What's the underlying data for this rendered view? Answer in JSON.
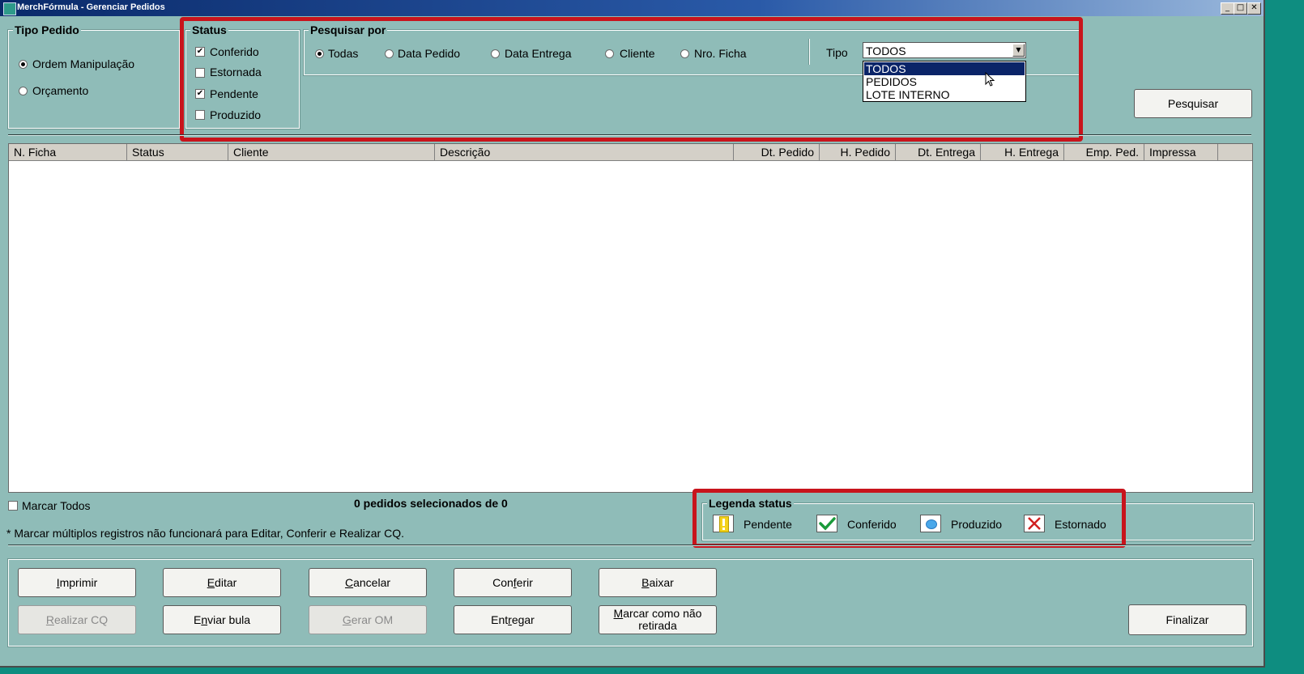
{
  "window": {
    "title": "MerchFórmula - Gerenciar Pedidos"
  },
  "tipo_pedido": {
    "legend": "Tipo Pedido",
    "options": [
      {
        "label": "Ordem Manipulação",
        "selected": true
      },
      {
        "label": "Orçamento",
        "selected": false
      }
    ]
  },
  "status": {
    "legend": "Status",
    "options": [
      {
        "label": "Conferido",
        "checked": true
      },
      {
        "label": "Estornada",
        "checked": false
      },
      {
        "label": "Pendente",
        "checked": true
      },
      {
        "label": "Produzido",
        "checked": false
      }
    ]
  },
  "pesquisar_por": {
    "legend": "Pesquisar por",
    "options": [
      {
        "label": "Todas",
        "selected": true
      },
      {
        "label": "Data Pedido",
        "selected": false
      },
      {
        "label": "Data Entrega",
        "selected": false
      },
      {
        "label": "Cliente",
        "selected": false
      },
      {
        "label": "Nro. Ficha",
        "selected": false
      }
    ],
    "tipo_label": "Tipo",
    "tipo_value": "TODOS",
    "tipo_options": [
      "TODOS",
      "PEDIDOS",
      "LOTE INTERNO"
    ]
  },
  "pesquisar_button": "Pesquisar",
  "table": {
    "columns": [
      "N. Ficha",
      "Status",
      "Cliente",
      "Descrição",
      "Dt. Pedido",
      "H. Pedido",
      "Dt. Entrega",
      "H. Entrega",
      "Emp. Ped.",
      "Impressa"
    ],
    "rows": []
  },
  "marcar_todos": {
    "label": "Marcar Todos",
    "checked": false
  },
  "selection_count": "0 pedidos selecionados de 0",
  "note": "* Marcar múltiplos registros não funcionará para Editar, Conferir e Realizar CQ.",
  "legenda": {
    "legend": "Legenda status",
    "items": [
      {
        "label": "Pendente",
        "icon": "exclamation-icon"
      },
      {
        "label": "Conferido",
        "icon": "checkmark-icon"
      },
      {
        "label": "Produzido",
        "icon": "blue-dot-icon"
      },
      {
        "label": "Estornado",
        "icon": "red-x-icon"
      }
    ]
  },
  "buttons": {
    "imprimir": {
      "label": "Imprimir",
      "key": "I",
      "rest": "mprimir"
    },
    "editar": {
      "label": "Editar",
      "key": "E",
      "rest": "ditar"
    },
    "cancelar": {
      "label": "Cancelar",
      "key": "C",
      "rest": "ancelar"
    },
    "conferir": {
      "label": "Conferir",
      "pre": "Con",
      "key": "f",
      "rest": "erir"
    },
    "baixar": {
      "label": "Baixar",
      "key": "B",
      "rest": "aixar"
    },
    "realizar_cq": {
      "label": "Realizar CQ",
      "key": "R",
      "rest": "ealizar CQ",
      "disabled": true
    },
    "enviar_bula": {
      "label": "Enviar bula",
      "pre": "E",
      "key": "n",
      "rest": "viar bula"
    },
    "gerar_om": {
      "label": "Gerar OM",
      "key": "G",
      "rest": "erar OM",
      "disabled": true
    },
    "entregar": {
      "label": "Entregar",
      "pre": "Ent",
      "key": "r",
      "rest": "egar"
    },
    "marcar_nao_retirada": {
      "line1_key": "M",
      "line1_rest": "arcar como não",
      "line2": "retirada"
    },
    "finalizar": {
      "label": "Finalizar"
    }
  },
  "colors": {
    "window_bg": "#8fbcb8",
    "highlight": "#c8141c",
    "title_bar": "#0a2a6a"
  }
}
